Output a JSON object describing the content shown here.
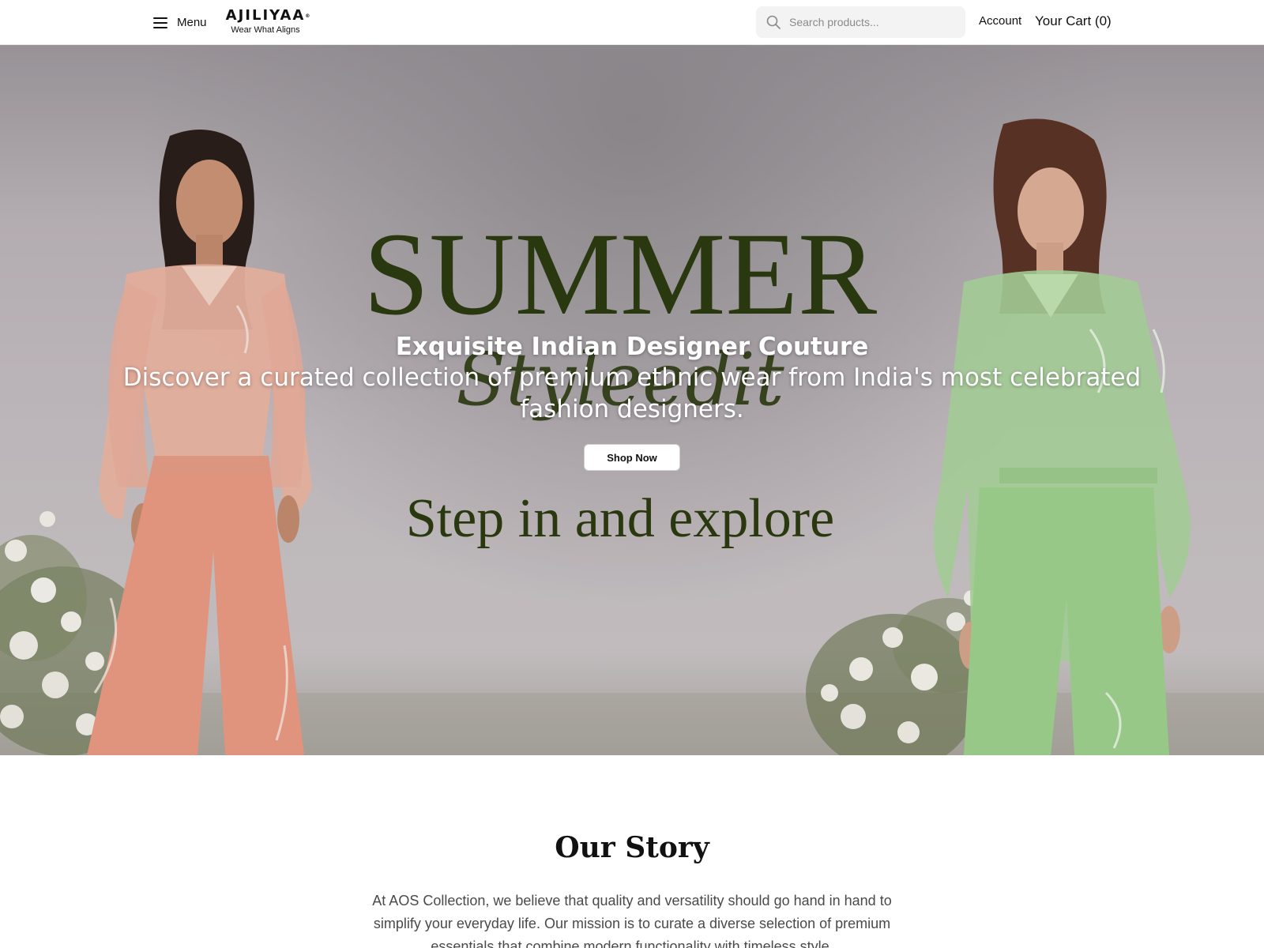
{
  "header": {
    "menu_label": "Menu",
    "logo_brand": "AJILIYAA",
    "logo_tagline": "Wear What Aligns",
    "search_placeholder": "Search products...",
    "account_label": "Account",
    "cart_label": "Your Cart (0)"
  },
  "hero": {
    "banner_title": "SUMMER",
    "banner_script": "Styleedit",
    "banner_bottom": "Step in and explore",
    "heading": "Exquisite Indian Designer Couture",
    "subheading": "Discover a curated collection of premium ethnic wear from India's most celebrated fashion designers.",
    "cta_label": "Shop Now",
    "banner_text_color": "#2c3a10"
  },
  "story": {
    "title": "Our Story",
    "text": "At AOS Collection, we believe that quality and versatility should go hand in hand to simplify your everyday life. Our mission is to curate a diverse selection of premium essentials that combine modern functionality with timeless style."
  }
}
